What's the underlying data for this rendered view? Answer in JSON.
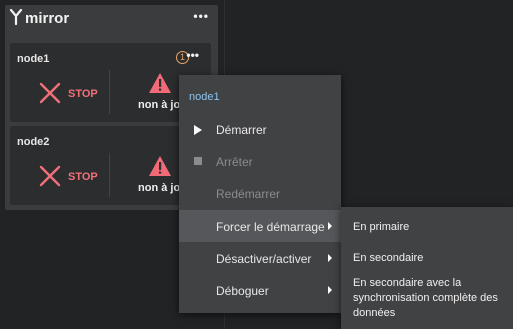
{
  "group": {
    "title": "mirror",
    "menu": "•••"
  },
  "nodes": [
    {
      "name": "node1",
      "badge": "1",
      "menu": "•••",
      "status": "STOP",
      "warning": "non à jour"
    },
    {
      "name": "node2",
      "menu": "•••",
      "status": "STOP",
      "warning": "non à jour"
    }
  ],
  "context_menu": {
    "title": "node1",
    "items": [
      {
        "label": "Démarrer",
        "icon": "play-icon",
        "enabled": true
      },
      {
        "label": "Arrêter",
        "icon": "stop-square-icon",
        "enabled": false
      },
      {
        "label": "Redémarrer",
        "enabled": false
      },
      {
        "label": "Forcer le démarrage",
        "submenu": true,
        "highlighted": true
      },
      {
        "label": "Désactiver/activer",
        "submenu": true
      },
      {
        "label": "Déboguer",
        "submenu": true
      }
    ]
  },
  "submenu": {
    "items": [
      {
        "label": "En primaire"
      },
      {
        "label": "En secondaire"
      },
      {
        "label": "En secondaire avec la synchronisation complète des données"
      }
    ]
  },
  "colors": {
    "stop": "#f07079",
    "warning": "#f06b77",
    "badge": "#e9a469",
    "menu_title": "#8ac4ef"
  }
}
